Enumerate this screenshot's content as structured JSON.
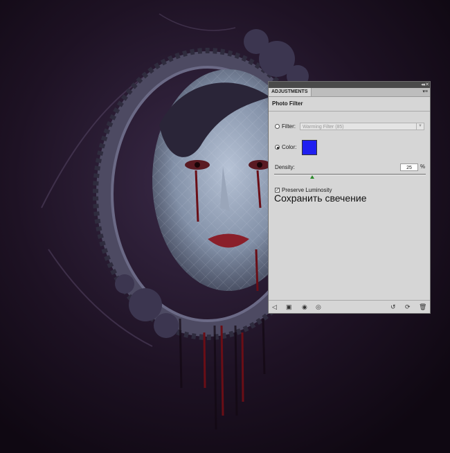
{
  "panel": {
    "tab_label": "ADJUSTMENTS",
    "collapse_icon": "double-arrow-left-icon",
    "close_icon": "close-icon",
    "menu_icon": "panel-menu-icon",
    "title": "Photo Filter",
    "filter": {
      "label": "Filter:",
      "value": "Warming Filter (85)",
      "selected": false
    },
    "color": {
      "label": "Color:",
      "selected": true,
      "swatch": "#1f1ff0"
    },
    "density": {
      "label": "Density:",
      "value": "25",
      "unit": "%",
      "level": 25
    },
    "preserve_luminosity": {
      "label": "Preserve Luminosity",
      "checked": true
    },
    "overlay_note": "Сохранить свечение",
    "footer_icons": [
      "return-to-list-icon",
      "expanded-view-icon",
      "layer-mask-icon",
      "eye-visibility-icon",
      "reset-previous-icon",
      "reset-default-icon",
      "delete-trash-icon"
    ]
  }
}
